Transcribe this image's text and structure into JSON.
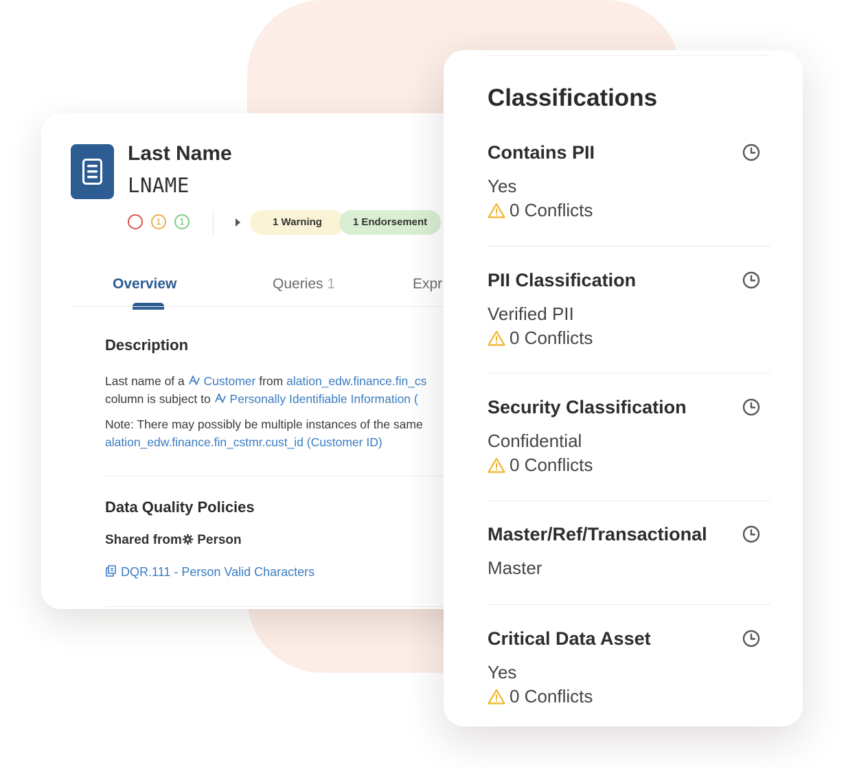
{
  "asset": {
    "title": "Last Name",
    "code": "LNAME",
    "ratings": [
      "1",
      "1"
    ],
    "warning_badge": "1 Warning",
    "endorsement_badge": "1 Endorsement"
  },
  "tabs": {
    "overview": "Overview",
    "queries": "Queries",
    "queries_count": "1",
    "expr": "Expr"
  },
  "description": {
    "heading": "Description",
    "line1": {
      "pre": "Last name of a ",
      "link1": "Customer",
      "mid": " from ",
      "link2": "alation_edw.finance.fin_cs"
    },
    "line2": {
      "pre": "column is subject to ",
      "link": "Personally Identifiable Information ("
    },
    "line3": "Note: There may possibly be multiple instances of the same",
    "line4_link": "alation_edw.finance.fin_cstmr.cust_id (Customer ID)"
  },
  "data_quality": {
    "heading": "Data Quality Policies",
    "shared_from_label": "Shared from",
    "shared_from_value": "Person",
    "rule_link": "DQR.111 - Person Valid Characters"
  },
  "classifications": {
    "title": "Classifications",
    "items": [
      {
        "name": "Contains PII",
        "value": "Yes",
        "conflicts": "0 Conflicts"
      },
      {
        "name": "PII Classification",
        "value": "Verified PII",
        "conflicts": "0 Conflicts"
      },
      {
        "name": "Security Classification",
        "value": "Confidential",
        "conflicts": "0 Conflicts"
      },
      {
        "name": "Master/Ref/Transactional",
        "value": "Master"
      },
      {
        "name": "Critical Data Asset",
        "value": "Yes",
        "conflicts": "0 Conflicts"
      }
    ]
  },
  "colors": {
    "brand_blue": "#2d5c93",
    "link_blue": "#3b7cc0",
    "warning_bg": "#fbf3d5",
    "endorsement_bg": "#d9efd3",
    "warning_icon": "#f0b429",
    "background_blob": "#fcede6"
  },
  "icons": {
    "asset": "database-column-icon",
    "glossary": "glossary-term-icon",
    "history": "clock-icon",
    "conflict": "warning-triangle-icon",
    "gear": "gear-icon",
    "rule": "rule-document-icon"
  }
}
